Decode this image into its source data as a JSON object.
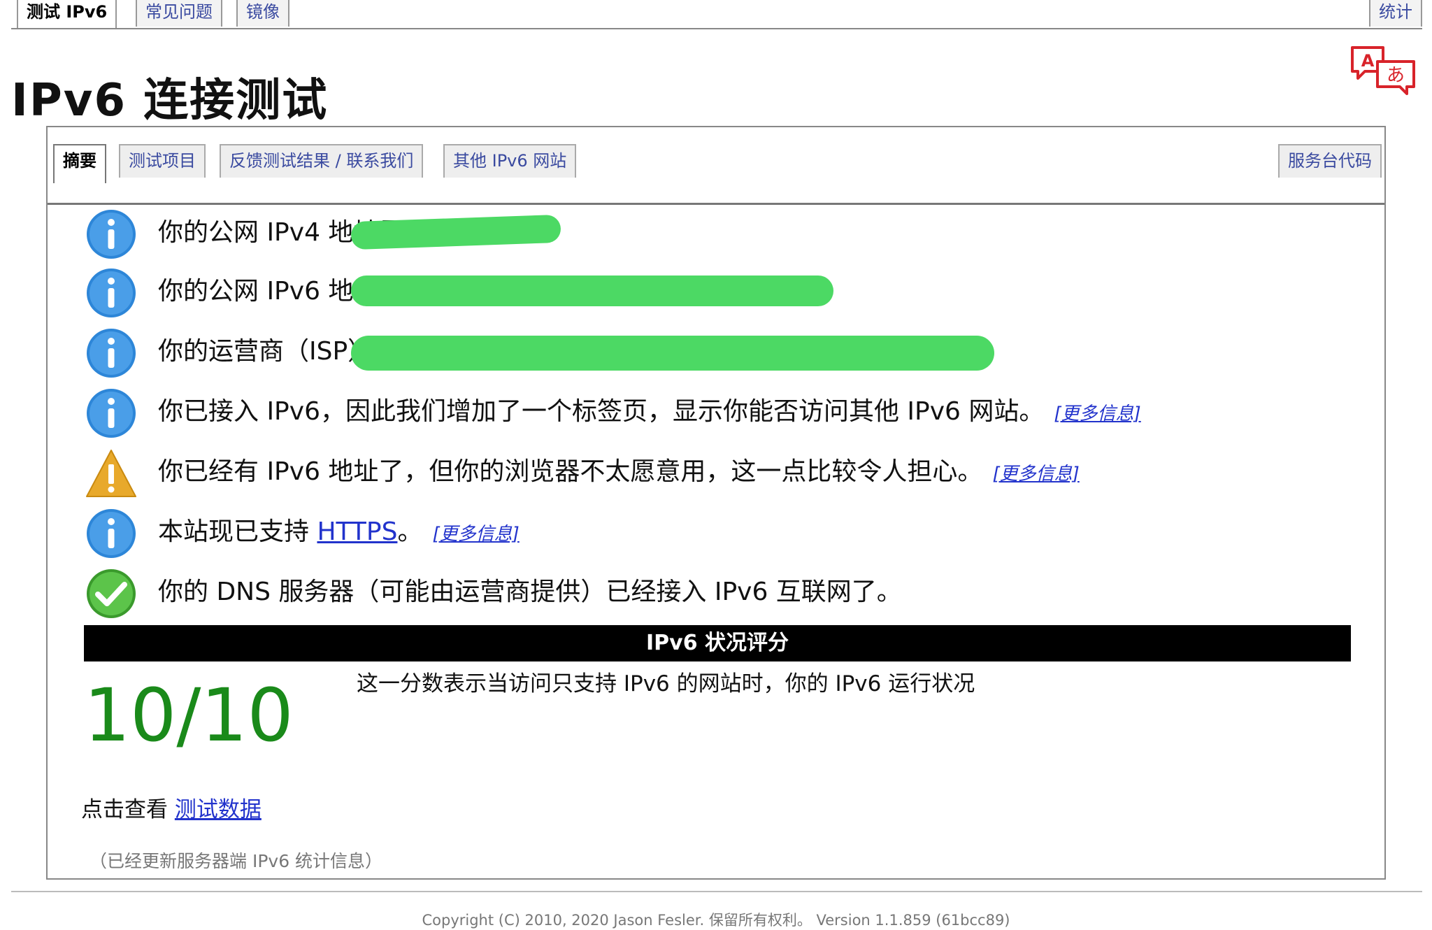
{
  "topnav": {
    "tabs": [
      {
        "label": "测试 IPv6"
      },
      {
        "label": "常见问题"
      },
      {
        "label": "镜像"
      }
    ],
    "stats_label": "统计"
  },
  "page_title": "IPv6 连接测试",
  "tabs": [
    {
      "label": "摘要"
    },
    {
      "label": "测试项目"
    },
    {
      "label": "反馈测试结果 / 联系我们"
    },
    {
      "label": "其他 IPv6 网站"
    }
  ],
  "helpdesk_tab": "服务台代码",
  "results": [
    {
      "icon": "info-icon",
      "text": "你的公网 IPv4 地址是"
    },
    {
      "icon": "info-icon",
      "text": "你的公网 IPv6 地址是"
    },
    {
      "icon": "info-icon",
      "text": "你的运营商（ISP）是"
    },
    {
      "icon": "info-icon",
      "text": "你已接入 IPv6，因此我们增加了一个标签页，显示你能否访问其他 IPv6 网站。",
      "more": "[更多信息]"
    },
    {
      "icon": "warning-icon",
      "text": "你已经有 IPv6 地址了，但你的浏览器不太愿意用，这一点比较令人担心。",
      "more": "[更多信息]"
    },
    {
      "icon": "info-icon",
      "text_before": "本站现已支持 ",
      "link": "HTTPS",
      "text_after": "。",
      "more": "[更多信息]"
    },
    {
      "icon": "check-icon",
      "text": "你的 DNS 服务器（可能由运营商提供）已经接入 IPv6 互联网了。"
    }
  ],
  "score": {
    "header": "IPv6 状况评分",
    "value": "10/10",
    "description": "这一分数表示当访问只支持 IPv6 的网站时，你的 IPv6 运行状况"
  },
  "detail": {
    "prefix": "点击查看 ",
    "link": "测试数据"
  },
  "updated_note": "（已经更新服务器端 IPv6 统计信息）",
  "footer": "Copyright (C) 2010, 2020 Jason Fesler. 保留所有权利。 Version 1.1.859 (61bcc89)",
  "colors": {
    "info": "#2d86d8",
    "warning": "#e8a92b",
    "ok": "#4ab83a",
    "score": "#1a8a1a",
    "redaction": "#4cd964",
    "link": "#2233cc"
  }
}
